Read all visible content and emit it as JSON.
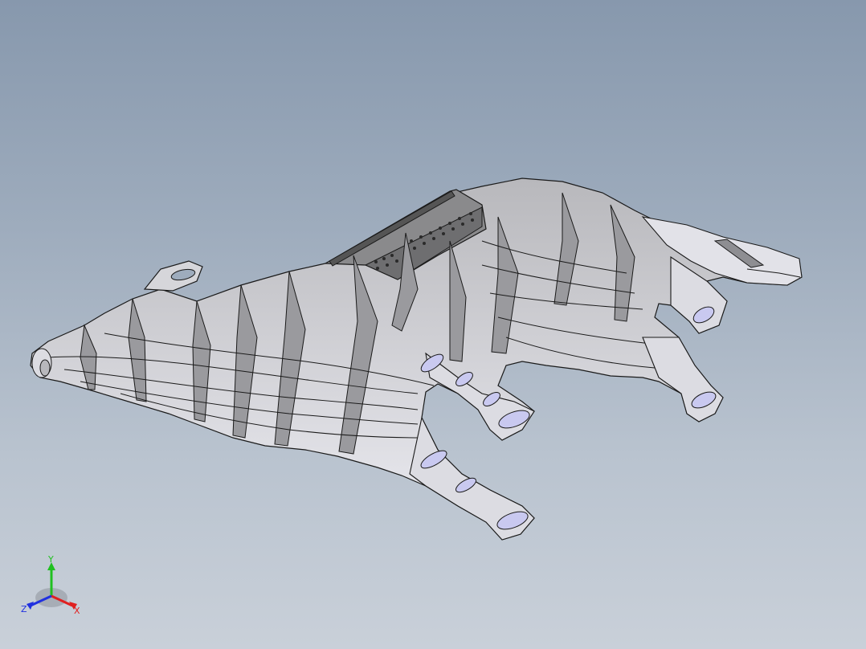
{
  "viewport": {
    "background_top": "#8798ad",
    "background_bottom": "#c9d0d9"
  },
  "model": {
    "description_icon": "cad-model",
    "fill_light": "#e6e6ee",
    "fill_mid": "#c8c8cc",
    "fill_dark": "#8e8e92",
    "fill_plate": "#7c7c7c",
    "edge_color": "#1a1a1a",
    "cut_face_color": "#c9c9f0"
  },
  "triad": {
    "x_label": "X",
    "y_label": "Y",
    "z_label": "Z",
    "x_color": "#e02020",
    "y_color": "#20c020",
    "z_color": "#2030e0"
  }
}
